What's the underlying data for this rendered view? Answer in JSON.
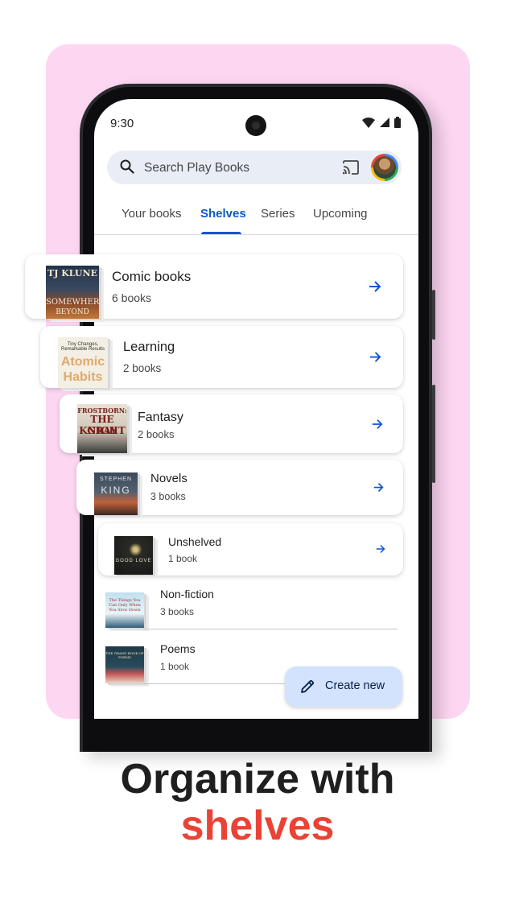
{
  "status": {
    "time": "9:30"
  },
  "search": {
    "placeholder": "Search Play Books"
  },
  "tabs": [
    {
      "label": "Your books",
      "active": false
    },
    {
      "label": "Shelves",
      "active": true
    },
    {
      "label": "Series",
      "active": false
    },
    {
      "label": "Upcoming",
      "active": false
    }
  ],
  "shelves": [
    {
      "title": "Comic books",
      "count": "6 books",
      "cover": {
        "line1": "TJ KLUNE",
        "line2": "SOMEWHERE",
        "line3": "BEYOND"
      }
    },
    {
      "title": "Learning",
      "count": "2 books",
      "cover": {
        "line1": "Tiny Changes, Remarkable Results",
        "line2": "Atomic",
        "line3": "Habits"
      }
    },
    {
      "title": "Fantasy",
      "count": "2 books",
      "cover": {
        "line1": "FROSTBORN:",
        "line2": "THE GRAY",
        "line3": "KNIGHT"
      }
    },
    {
      "title": "Novels",
      "count": "3 books",
      "cover": {
        "line1": "STEPHEN",
        "line2": "KING"
      }
    },
    {
      "title": "Unshelved",
      "count": "1 book",
      "cover": {
        "line1": "GOOD LOVE"
      }
    },
    {
      "title": "Non-fiction",
      "count": "3 books",
      "cover": {
        "line1": "The Things You Can Only When You Slow Down"
      }
    },
    {
      "title": "Poems",
      "count": "1 book",
      "cover": {
        "line1": "THE GRAND BOOK OF POEMS"
      }
    }
  ],
  "fab": {
    "label": "Create new"
  },
  "headline": {
    "line1": "Organize with",
    "line2": "shelves"
  },
  "colors": {
    "accent": "#0b57d0",
    "headline_accent": "#ea4335",
    "promo_bg": "#fdd6f2",
    "fab_bg": "#d3e3fd"
  }
}
